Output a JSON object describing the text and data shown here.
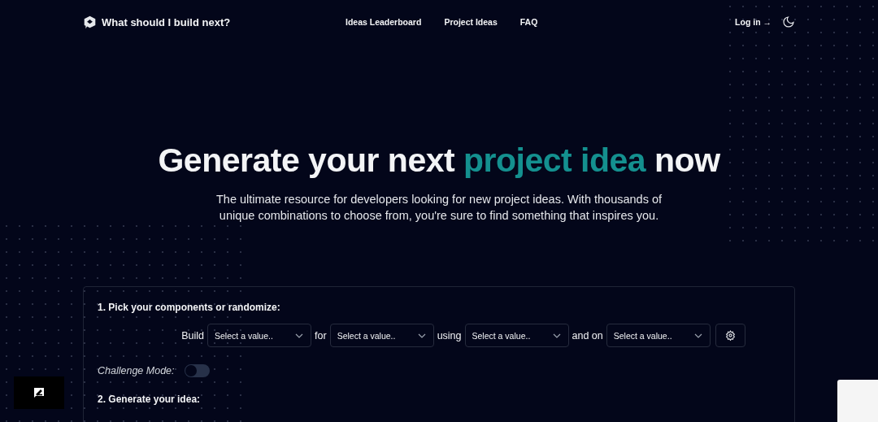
{
  "nav": {
    "brand": "What should I build next?",
    "links": [
      "Ideas Leaderboard",
      "Project Ideas",
      "FAQ"
    ],
    "login": "Log in →"
  },
  "hero": {
    "title_before": "Generate your next ",
    "title_highlight": "project idea",
    "title_after": " now",
    "subtitle": "The ultimate resource for developers looking for new project ideas. With thousands of unique combinations to choose from, you're sure to find something that inspires you."
  },
  "step1": {
    "heading": "1. Pick your components or randomize:",
    "parts": [
      {
        "word": "Build",
        "placeholder": "Select a value.."
      },
      {
        "word": "for",
        "placeholder": "Select a value.."
      },
      {
        "word": "using",
        "placeholder": "Select a value.."
      },
      {
        "word": "and on",
        "placeholder": "Select a value.."
      }
    ],
    "challenge_label": "Challenge Mode:",
    "challenge_on": false
  },
  "step2": {
    "heading": "2. Generate your idea:"
  }
}
